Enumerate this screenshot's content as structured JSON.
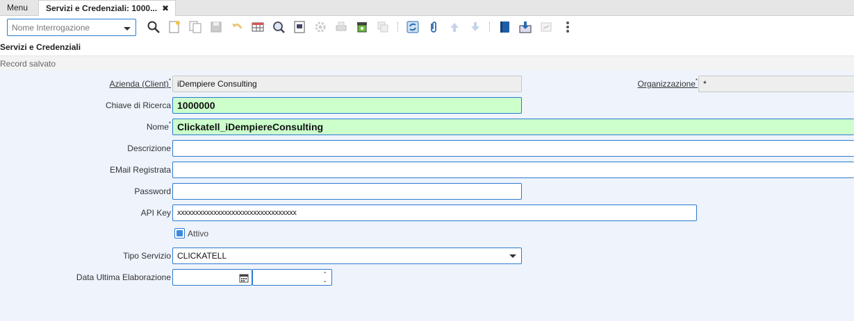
{
  "tabs": {
    "menu_label": "Menu",
    "active_label": "Servizi e Credenziali: 1000...",
    "close_symbol": "✖"
  },
  "toolbar": {
    "query_placeholder": "Nome Interrogazione",
    "icons": [
      "find-icon",
      "new-record-icon",
      "copy-record-icon",
      "save-icon",
      "undo-icon",
      "grid-toggle-icon",
      "zoom-icon",
      "report-icon",
      "process-icon",
      "print-icon",
      "archive-icon",
      "delete-icon",
      "refresh-icon",
      "attachment-icon",
      "previous-record-icon",
      "next-record-icon",
      "detail-icon",
      "export-icon",
      "customize-icon",
      "more-icon"
    ]
  },
  "window": {
    "title": "Servizi e Credenziali",
    "status": "Record salvato"
  },
  "form": {
    "client_label": "Azienda (Client)",
    "client_value": "iDempiere Consulting",
    "org_label": "Organizzazione",
    "org_value": "*",
    "search_key_label": "Chiave di Ricerca",
    "search_key_value": "1000000",
    "name_label": "Nome",
    "name_value": "Clickatell_iDempiereConsulting",
    "description_label": "Descrizione",
    "description_value": "",
    "email_label": "EMail Registrata",
    "email_value": "",
    "password_label": "Password",
    "password_value": "",
    "apikey_label": "API Key",
    "apikey_value": "xxxxxxxxxxxxxxxxxxxxxxxxxxxxxxxxx",
    "active_label": "Attivo",
    "active_checked": true,
    "service_type_label": "Tipo Servizio",
    "service_type_value": "CLICKATELL",
    "last_run_label": "Data Ultima Elaborazione",
    "last_run_date": "",
    "last_run_time": ""
  },
  "colors": {
    "accent": "#2a7ad0",
    "mandatory_bg": "#ccffcc",
    "form_bg": "#eef3fc"
  }
}
